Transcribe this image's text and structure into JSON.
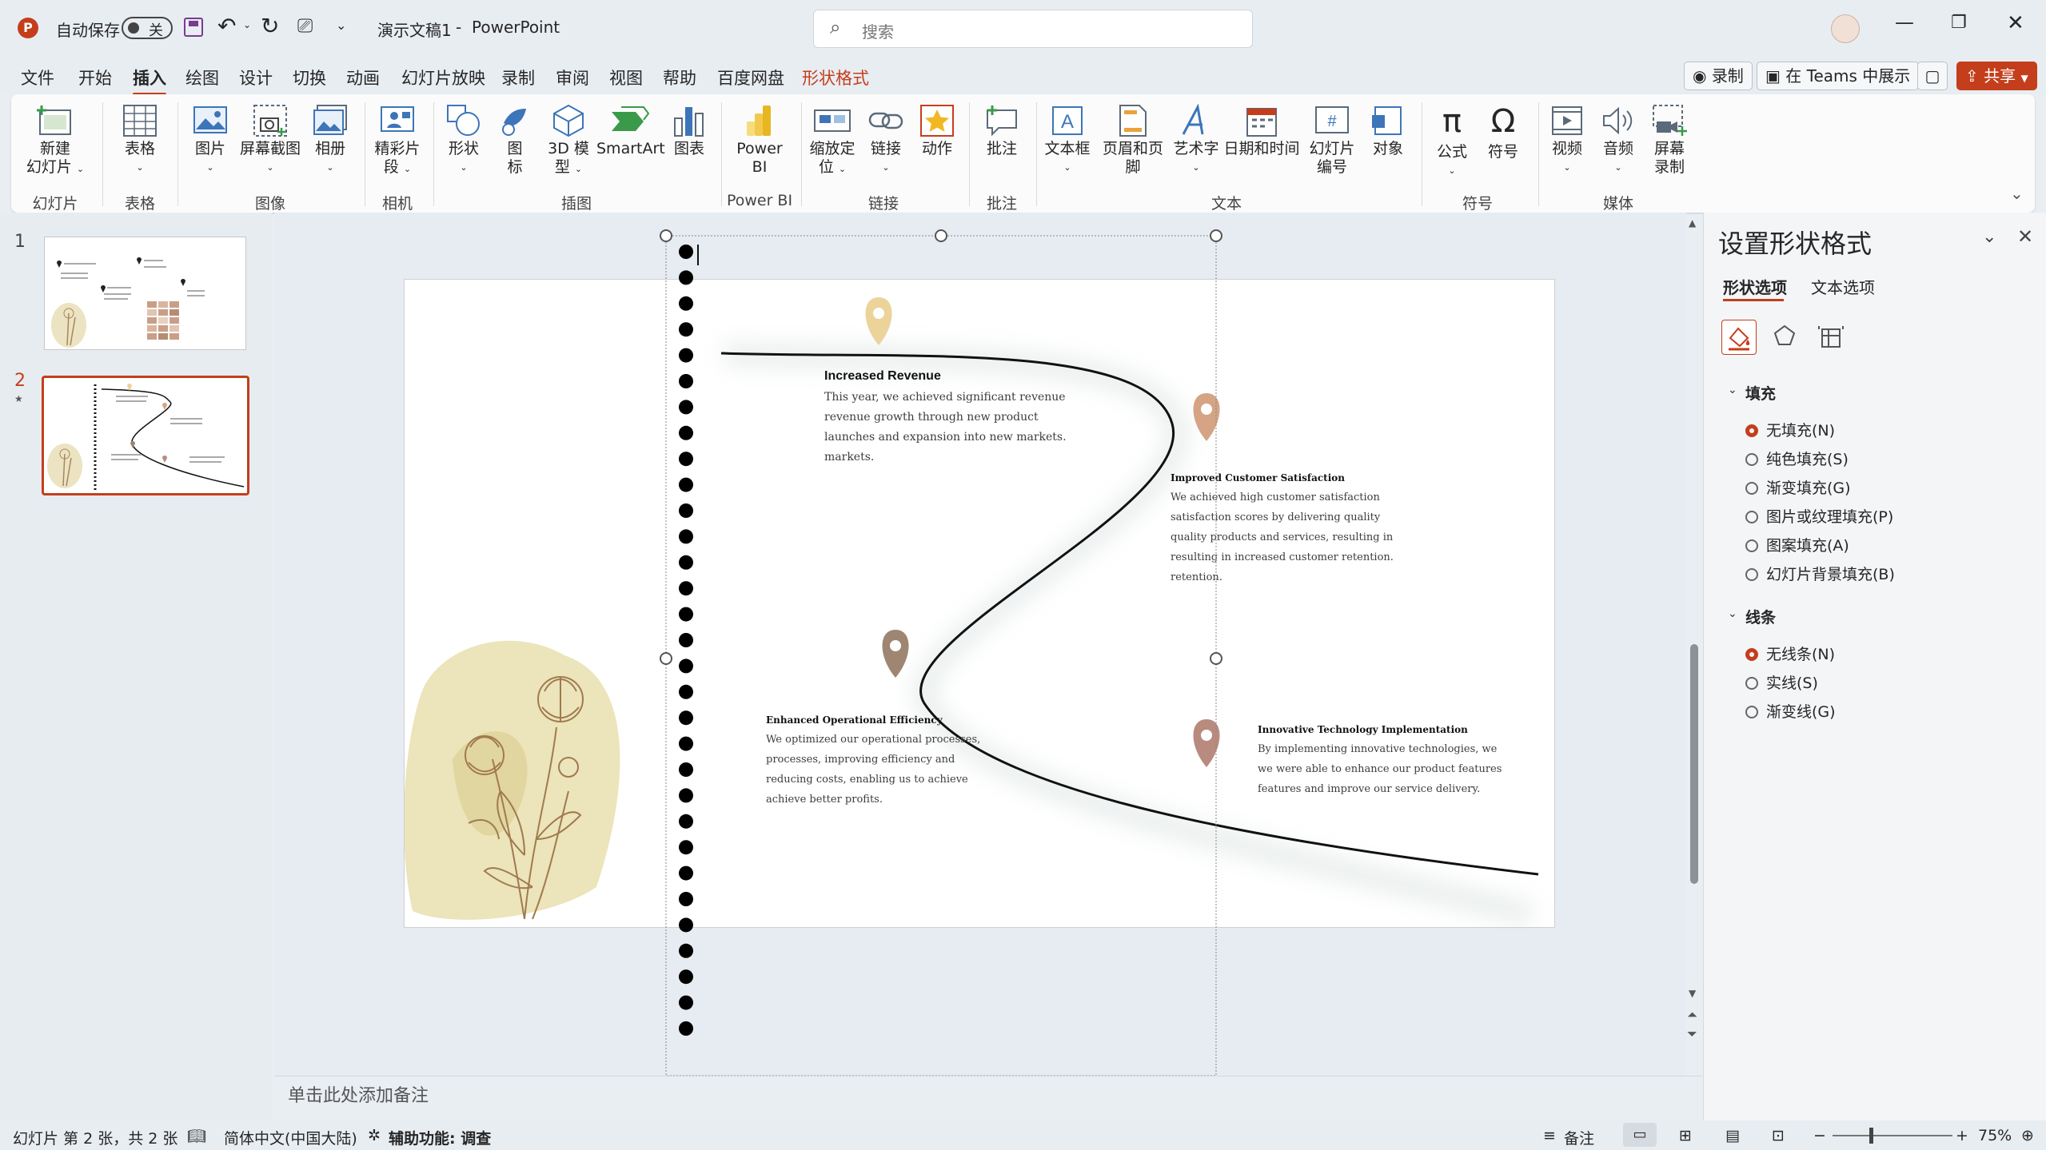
{
  "titlebar": {
    "autosave_label": "自动保存",
    "autosave_state": "关",
    "doc_title": "演示文稿1",
    "separator": "-",
    "app_name": "PowerPoint",
    "search_placeholder": "搜索"
  },
  "menu": {
    "items": [
      "文件",
      "开始",
      "插入",
      "绘图",
      "设计",
      "切换",
      "动画",
      "幻灯片放映",
      "录制",
      "审阅",
      "视图",
      "帮助",
      "百度网盘",
      "形状格式"
    ],
    "record_button": "录制",
    "teams_button": "在 Teams 中展示",
    "share_button": "共享"
  },
  "ribbon": {
    "buttons": {
      "new_slide": [
        "新建",
        "幻灯片"
      ],
      "table": "表格",
      "picture": "图片",
      "screenshot": "屏幕截图",
      "album": "相册",
      "cameo": [
        "精彩片",
        "段"
      ],
      "shapes": "形状",
      "icons": [
        "图",
        "标"
      ],
      "model3d": [
        "3D 模",
        "型"
      ],
      "smartart": "SmartArt",
      "chart": "图表",
      "powerbi": [
        "Power",
        "BI"
      ],
      "zoom": [
        "缩放定",
        "位"
      ],
      "link": "链接",
      "action": "动作",
      "comment": "批注",
      "textbox": "文本框",
      "header_footer": "页眉和页脚",
      "wordart": "艺术字",
      "datetime": "日期和时间",
      "slide_number": [
        "幻灯片",
        "编号"
      ],
      "object": "对象",
      "equation": "公式",
      "symbol": "符号",
      "video": "视频",
      "audio": "音频",
      "screen_recording": [
        "屏幕",
        "录制"
      ]
    },
    "groups": {
      "slides": "幻灯片",
      "tables": "表格",
      "images": "图像",
      "camera": "相机",
      "illustrations": "插图",
      "powerbi": "Power BI",
      "links": "链接",
      "comments": "批注",
      "text": "文本",
      "symbols": "符号",
      "media": "媒体"
    }
  },
  "thumbnails": [
    {
      "number": "1"
    },
    {
      "number": "2",
      "star": "★"
    }
  ],
  "slide": {
    "items": [
      {
        "title": "Increased Revenue",
        "body": [
          "This year, we achieved significant revenue",
          "revenue growth through new product",
          "launches and expansion into new markets.",
          "markets."
        ]
      },
      {
        "title": "Improved Customer Satisfaction",
        "body": [
          "We achieved high customer satisfaction",
          "satisfaction scores by delivering quality",
          "quality products and services, resulting in",
          "resulting in increased customer retention.",
          "retention."
        ]
      },
      {
        "title": "Enhanced Operational Efficiency",
        "body": [
          "We optimized our operational processes,",
          "processes, improving efficiency and",
          "reducing costs, enabling us to achieve",
          "achieve better profits."
        ]
      },
      {
        "title": "Innovative Technology Implementation",
        "body": [
          "By implementing innovative technologies, we",
          "we were able to enhance our product features",
          "features and improve our service delivery."
        ]
      }
    ],
    "pin_colors": [
      "#ecd39a",
      "#d4a484",
      "#9e8672",
      "#b98b7e"
    ]
  },
  "notes_placeholder": "单击此处添加备注",
  "panel": {
    "title": "设置形状格式",
    "tabs": [
      "形状选项",
      "文本选项"
    ],
    "fill_header": "填充",
    "fill_options": [
      "无填充(N)",
      "纯色填充(S)",
      "渐变填充(G)",
      "图片或纹理填充(P)",
      "图案填充(A)",
      "幻灯片背景填充(B)"
    ],
    "line_header": "线条",
    "line_options": [
      "无线条(N)",
      "实线(S)",
      "渐变线(G)"
    ]
  },
  "status": {
    "slide_info": "幻灯片 第 2 张，共 2 张",
    "language": "简体中文(中国大陆)",
    "accessibility": "辅助功能: 调查",
    "notes": "备注",
    "zoom": "75%"
  },
  "colors": {
    "accent": "#c43e1c",
    "curve": "#111111"
  }
}
